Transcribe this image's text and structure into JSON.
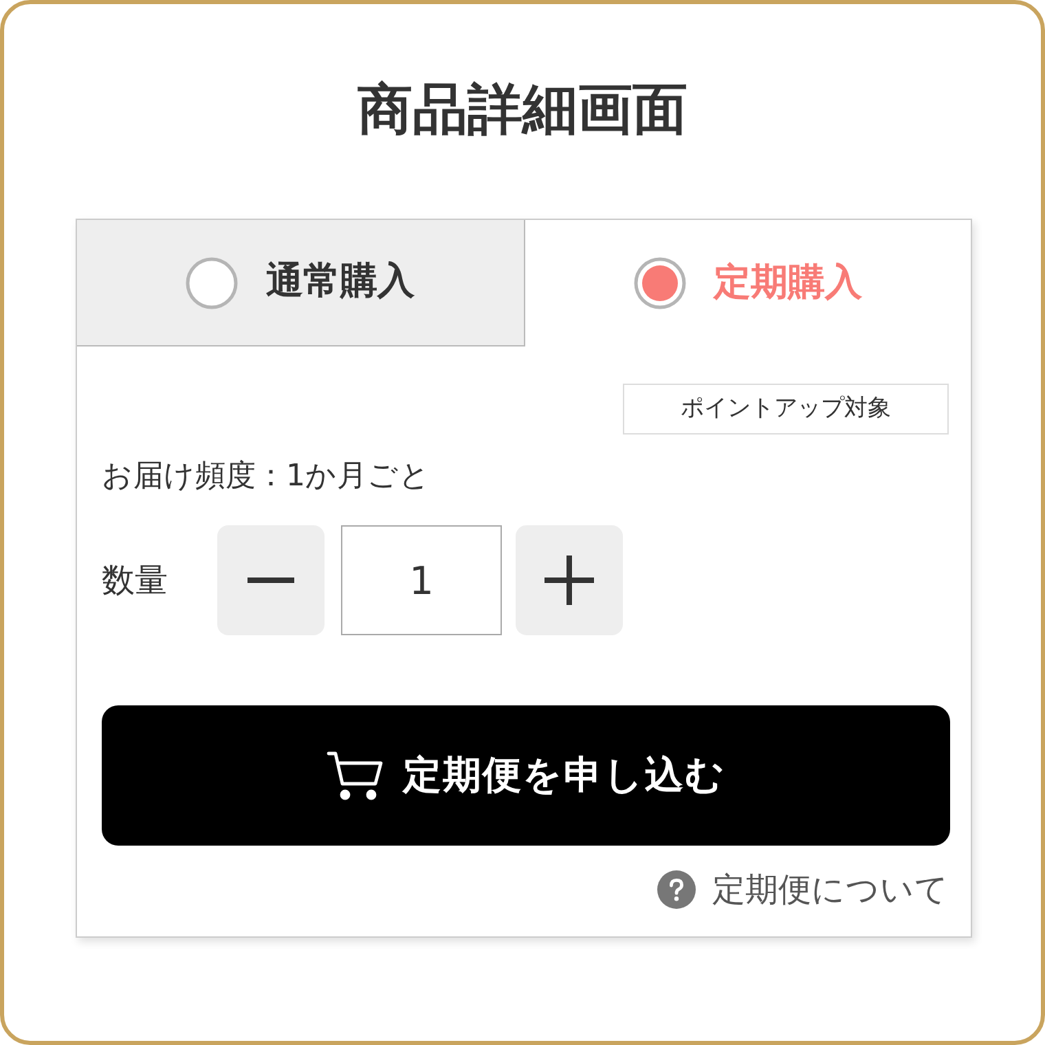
{
  "title": "商品詳細画面",
  "purchase_tabs": [
    {
      "label": "通常購入",
      "selected": false
    },
    {
      "label": "定期購入",
      "selected": true
    }
  ],
  "badge": "ポイントアップ対象",
  "delivery_frequency": "お届け頻度：1か月ごと",
  "quantity": {
    "label": "数量",
    "value": "1"
  },
  "submit_button": {
    "label": "定期便を申し込む"
  },
  "help_link": {
    "label": "定期便について"
  }
}
